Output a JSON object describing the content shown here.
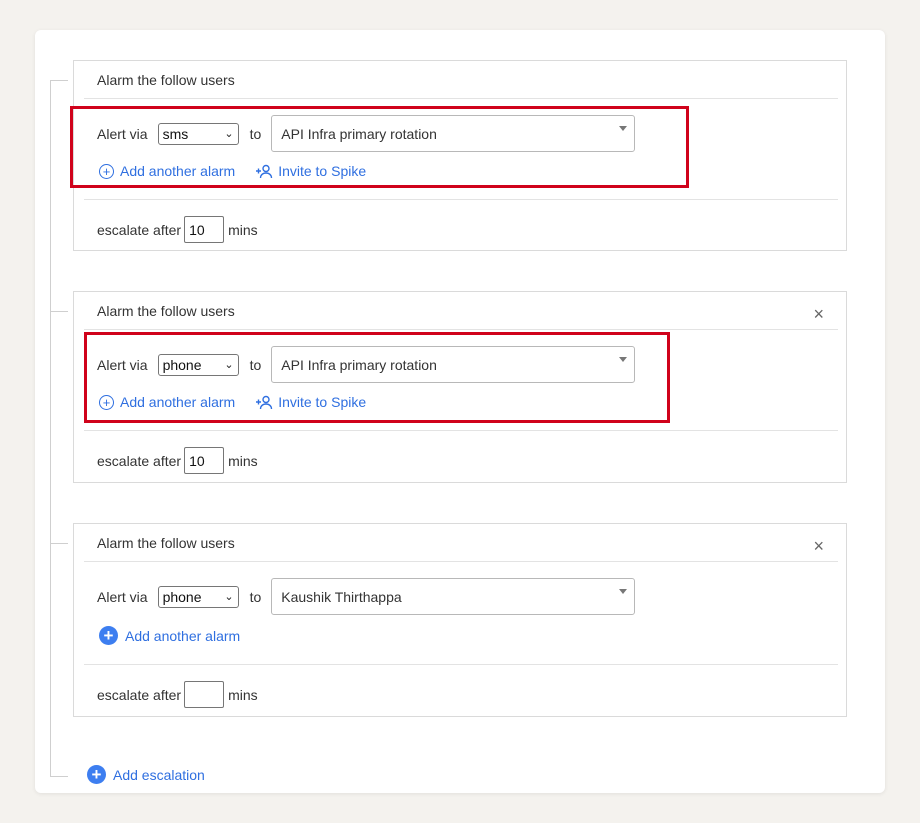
{
  "blocks": [
    {
      "title": "Alarm the follow users",
      "has_close": false,
      "alert_label": "Alert via",
      "channel": "sms",
      "to_label": "to",
      "target": "API Infra primary rotation",
      "add_alarm": "Add another alarm",
      "invite": "Invite to Spike",
      "escalate_label": "escalate after",
      "escalate_value": "10",
      "mins_label": "mins"
    },
    {
      "title": "Alarm the follow users",
      "has_close": true,
      "alert_label": "Alert via",
      "channel": "phone",
      "to_label": "to",
      "target": "API Infra primary rotation",
      "add_alarm": "Add another alarm",
      "invite": "Invite to Spike",
      "escalate_label": "escalate after",
      "escalate_value": "10",
      "mins_label": "mins"
    },
    {
      "title": "Alarm the follow users",
      "has_close": true,
      "alert_label": "Alert via",
      "channel": "phone",
      "to_label": "to",
      "target": "Kaushik Thirthappa",
      "add_alarm": "Add another alarm",
      "escalate_label": "escalate after",
      "escalate_value": "",
      "mins_label": "mins"
    }
  ],
  "close_symbol": "×",
  "add_escalation": "Add escalation",
  "highlight_color": "#d0021b",
  "link_color": "#2f6fe0",
  "icons": [
    "plus-circle-outline-icon",
    "person-add-icon",
    "plus-circle-solid-icon",
    "close-icon",
    "chevron-down-icon"
  ]
}
